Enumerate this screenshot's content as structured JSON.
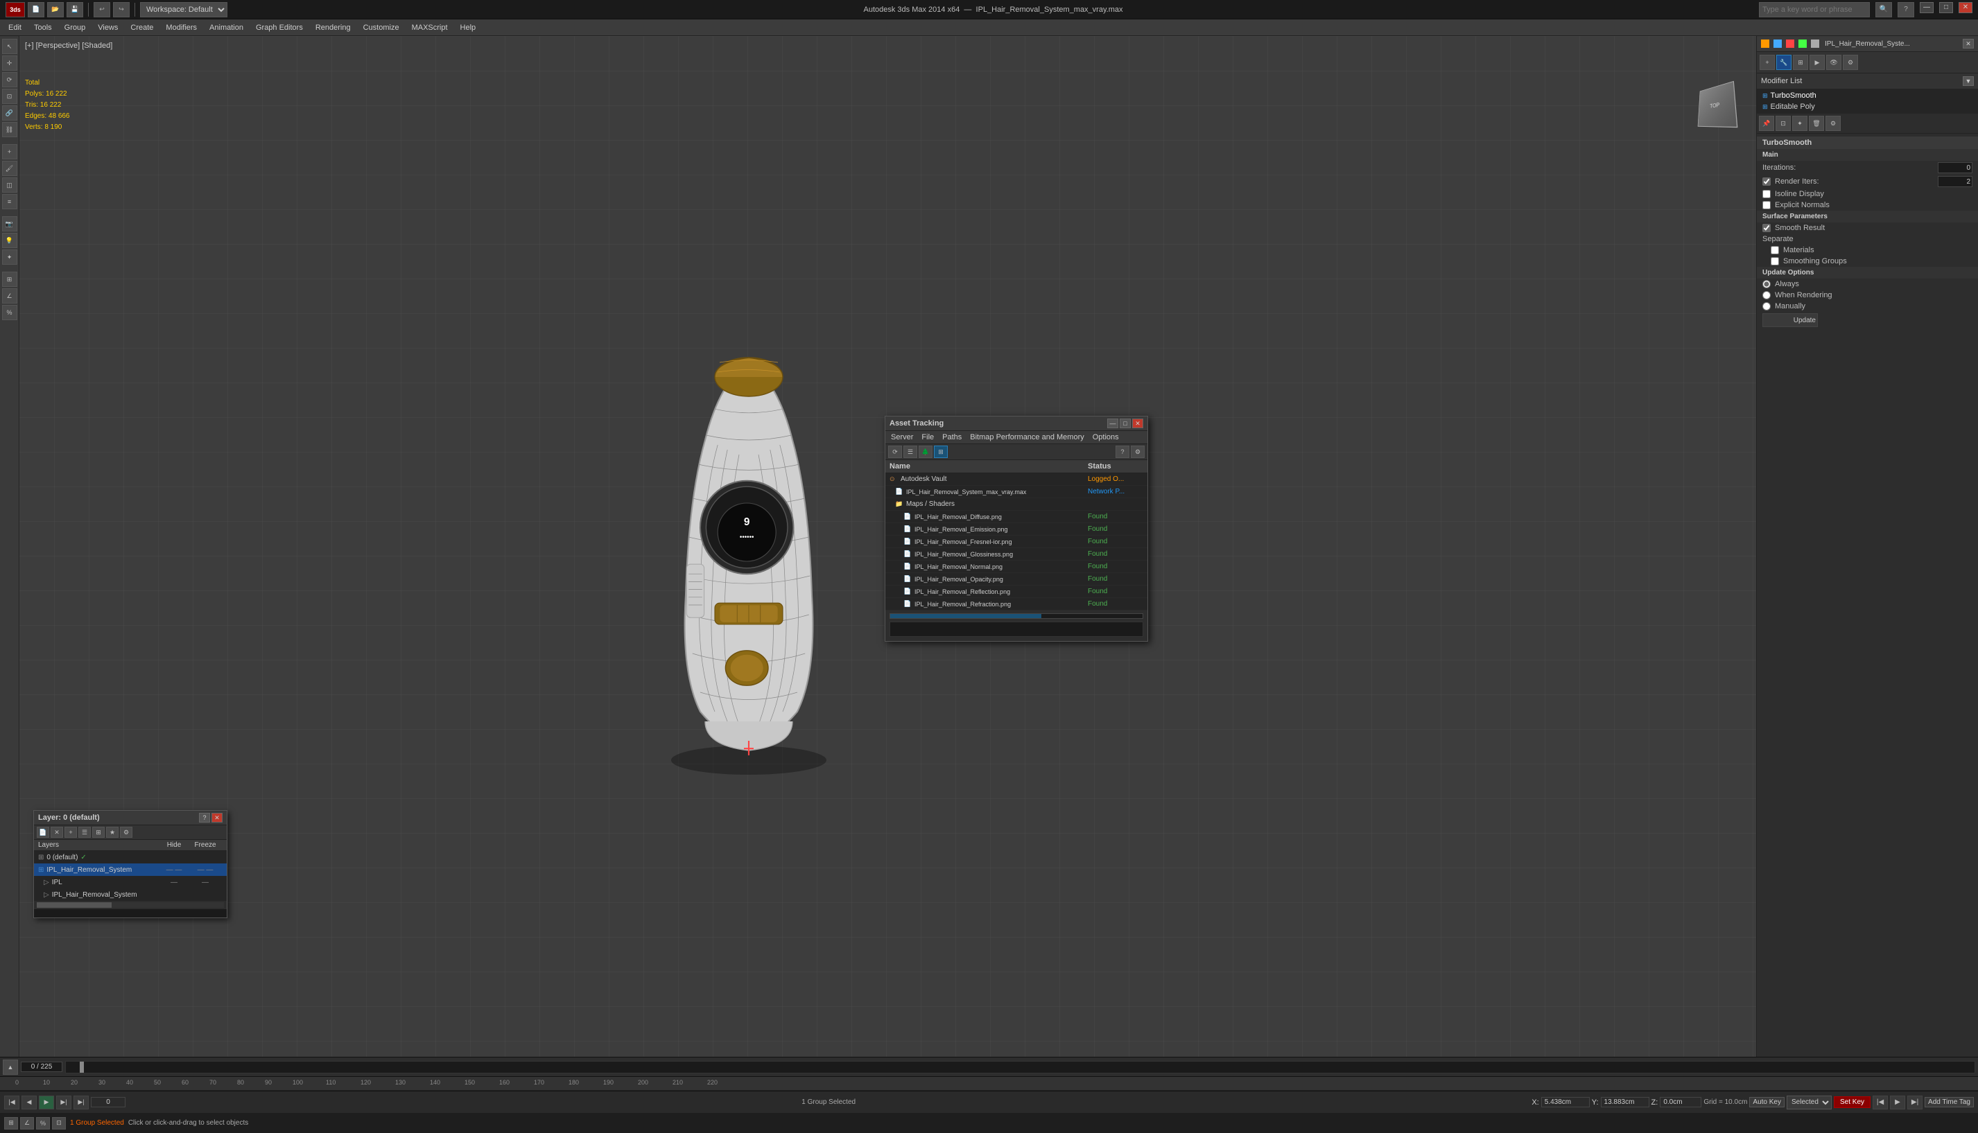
{
  "titlebar": {
    "app_title": "Autodesk 3ds Max 2014 x64",
    "file_name": "IPL_Hair_Removal_System_max_vray.max",
    "workspace_label": "Workspace: Default",
    "search_placeholder": "Type a key word or phrase",
    "min_btn": "—",
    "max_btn": "□",
    "close_btn": "✕"
  },
  "menubar": {
    "items": [
      "Edit",
      "Tools",
      "Group",
      "Views",
      "Create",
      "Modifiers",
      "Animation",
      "Graph Editors",
      "Rendering",
      "Customize",
      "MAXScript",
      "Help"
    ]
  },
  "viewport": {
    "label": "[+] [Perspective] [Shaded]",
    "stats": {
      "label": "Total",
      "polys": "Polys: 16 222",
      "tris": "Tris:  16 222",
      "edges": "Edges: 48 666",
      "verts": "Verts: 8 190"
    }
  },
  "right_panel": {
    "title": "IPL_Hair_Removal_Syste...",
    "modifier_list_label": "Modifier List",
    "modifiers": [
      "TurboSmooth",
      "Editable Poly"
    ],
    "turbosmooth": {
      "title": "TurboSmooth",
      "main_label": "Main",
      "iterations_label": "Iterations:",
      "iterations_value": "0",
      "render_iters_label": "Render Iters:",
      "render_iters_value": "2",
      "isoline_display": "Isoline Display",
      "explicit_normals": "Explicit Normals",
      "surface_params_label": "Surface Parameters",
      "smooth_result": "Smooth Result",
      "separate_label": "Separate",
      "materials": "Materials",
      "smoothing_groups": "Smoothing Groups",
      "update_options_label": "Update Options",
      "always": "Always",
      "when_rendering": "When Rendering",
      "manually": "Manually",
      "update_btn": "Update"
    }
  },
  "asset_tracking": {
    "title": "Asset Tracking",
    "menus": [
      "Server",
      "File",
      "Paths",
      "Bitmap Performance and Memory",
      "Options"
    ],
    "col_name": "Name",
    "col_status": "Status",
    "rows": [
      {
        "indent": 0,
        "icon": "vault",
        "name": "Autodesk Vault",
        "status": "Logged O...",
        "status_class": "status-logged"
      },
      {
        "indent": 1,
        "icon": "file",
        "name": "IPL_Hair_Removal_System_max_vray.max",
        "status": "Network P...",
        "status_class": "status-network"
      },
      {
        "indent": 1,
        "icon": "folder",
        "name": "Maps / Shaders",
        "status": "",
        "status_class": ""
      },
      {
        "indent": 2,
        "icon": "file",
        "name": "IPL_Hair_Removal_Diffuse.png",
        "status": "Found",
        "status_class": "status-found"
      },
      {
        "indent": 2,
        "icon": "file",
        "name": "IPL_Hair_Removal_Emission.png",
        "status": "Found",
        "status_class": "status-found"
      },
      {
        "indent": 2,
        "icon": "file",
        "name": "IPL_Hair_Removal_Fresnel-ior.png",
        "status": "Found",
        "status_class": "status-found"
      },
      {
        "indent": 2,
        "icon": "file",
        "name": "IPL_Hair_Removal_Glossiness.png",
        "status": "Found",
        "status_class": "status-found"
      },
      {
        "indent": 2,
        "icon": "file",
        "name": "IPL_Hair_Removal_Normal.png",
        "status": "Found",
        "status_class": "status-found"
      },
      {
        "indent": 2,
        "icon": "file",
        "name": "IPL_Hair_Removal_Opacity.png",
        "status": "Found",
        "status_class": "status-found"
      },
      {
        "indent": 2,
        "icon": "file",
        "name": "IPL_Hair_Removal_Reflection.png",
        "status": "Found",
        "status_class": "status-found"
      },
      {
        "indent": 2,
        "icon": "file",
        "name": "IPL_Hair_Removal_Refraction.png",
        "status": "Found",
        "status_class": "status-found"
      }
    ]
  },
  "layer_panel": {
    "title": "Layer: 0 (default)",
    "col_layers": "Layers",
    "col_hide": "Hide",
    "col_freeze": "Freeze",
    "layers": [
      {
        "indent": 0,
        "icon": "layer",
        "name": "0 (default)",
        "has_check": true,
        "hide": "",
        "freeze": ""
      },
      {
        "indent": 0,
        "icon": "layer",
        "name": "IPL_Hair_Removal_System",
        "selected": true,
        "hide": "—  —",
        "freeze": "—  —"
      },
      {
        "indent": 1,
        "icon": "object",
        "name": "IPL",
        "hide": "—",
        "freeze": "—"
      },
      {
        "indent": 1,
        "icon": "object",
        "name": "IPL_Hair_Removal_System",
        "hide": "",
        "freeze": ""
      }
    ]
  },
  "timeline": {
    "frame_current": "0 / 225",
    "marks": [
      "0",
      "10",
      "20",
      "30",
      "40",
      "50",
      "60",
      "70",
      "80",
      "90",
      "100",
      "110",
      "120",
      "130",
      "140",
      "150",
      "160",
      "170",
      "180",
      "190",
      "200",
      "210",
      "220"
    ]
  },
  "status_bar": {
    "selection_info": "1 Group Selected",
    "hint": "Click or click-and-drag to select objects",
    "x_label": "X:",
    "x_value": "5.438cm",
    "y_label": "Y:",
    "y_value": "13.883cm",
    "z_label": "Z:",
    "z_value": "0.0cm",
    "grid_label": "Grid = 10.0cm",
    "auto_key": "Auto Key",
    "set_key": "Set Key",
    "add_time_tag": "Add Time Tag"
  },
  "anim_controls": {
    "selected_label": "Selected",
    "frame_input": "0",
    "frame_total": "225"
  }
}
